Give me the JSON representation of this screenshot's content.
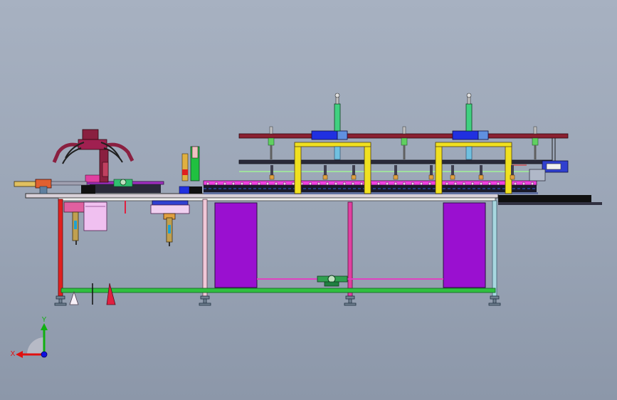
{
  "viewport": {
    "background_top": "#a7b1c1",
    "background_bottom": "#8c97a9"
  },
  "triad": {
    "x_label": "X",
    "y_label": "Y",
    "x_color": "#e01010",
    "y_color": "#10b010",
    "z_color": "#1010e0"
  },
  "colors": {
    "frame_red": "#e02020",
    "frame_green": "#30c040",
    "frame_pink": "#e040a0",
    "panel_purple": "#9a10d0",
    "gantry_yellow": "#f0e020",
    "rail_maroon": "#8a2030",
    "cylinder_blue": "#2030e0",
    "cylinder_green": "#40d080",
    "conveyor_magenta": "#e030e0",
    "leg_light": "#e0c0d0"
  }
}
